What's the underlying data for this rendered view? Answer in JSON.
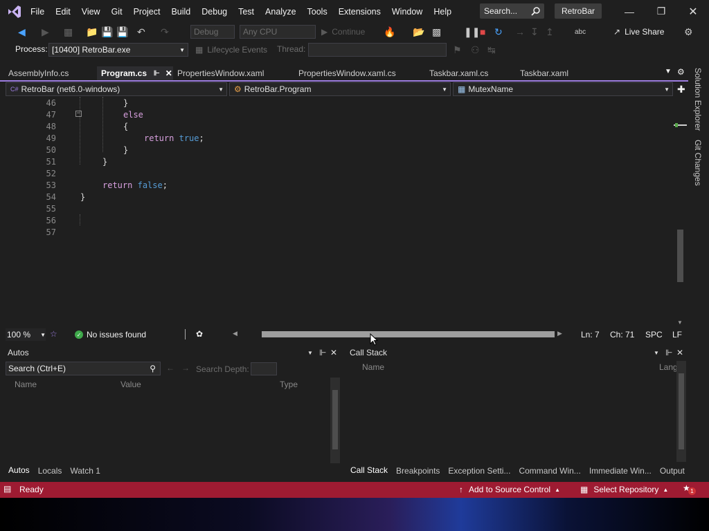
{
  "menu": {
    "items": [
      "File",
      "Edit",
      "View",
      "Git",
      "Project",
      "Build",
      "Debug",
      "Test",
      "Analyze",
      "Tools",
      "Extensions",
      "Window",
      "Help"
    ],
    "search_label": "Search...",
    "app_name": "RetroBar"
  },
  "toolbar": {
    "config": "Debug",
    "platform": "Any CPU",
    "continue_label": "Continue",
    "live_share_label": "Live Share"
  },
  "processbar": {
    "process_label": "Process:",
    "process_value": "[10400] RetroBar.exe",
    "lifecycle_label": "Lifecycle Events",
    "thread_label": "Thread:",
    "thread_value": ""
  },
  "tabs": [
    {
      "label": "AssemblyInfo.cs",
      "active": false
    },
    {
      "label": "Program.cs",
      "active": true
    },
    {
      "label": "PropertiesWindow.xaml",
      "active": false
    },
    {
      "label": "PropertiesWindow.xaml.cs",
      "active": false
    },
    {
      "label": "Taskbar.xaml.cs",
      "active": false
    },
    {
      "label": "Taskbar.xaml",
      "active": false
    }
  ],
  "navbar": {
    "project": "RetroBar (net6.0-windows)",
    "type": "RetroBar.Program",
    "member": "MutexName"
  },
  "editor": {
    "line_numbers": [
      "46",
      "47",
      "48",
      "49",
      "50",
      "51",
      "52",
      "53",
      "54",
      "55",
      "56",
      "57"
    ],
    "lines": [
      {
        "text": "}",
        "kind": "pn"
      },
      {
        "text": "else",
        "kind": "kw"
      },
      {
        "text": "{",
        "kind": "pn"
      },
      {
        "text_kw": "return",
        "text_val": "true",
        "tail": ";"
      },
      {
        "text": "}",
        "kind": "pn"
      },
      {
        "text": "}",
        "kind": "pn"
      },
      {
        "text": "",
        "kind": "pn"
      },
      {
        "text_kw": "return",
        "text_val": "false",
        "tail": ";"
      },
      {
        "text": "}",
        "kind": "pn"
      },
      {
        "text": "",
        "kind": "pn"
      },
      {
        "text": "",
        "kind": "pn"
      },
      {
        "text": "",
        "kind": "pn"
      }
    ]
  },
  "side": {
    "solution_explorer": "Solution Explorer",
    "git_changes": "Git Changes"
  },
  "editstatus": {
    "zoom": "100 %",
    "issues": "No issues found",
    "line": "Ln: 7",
    "col": "Ch: 71",
    "spacing": "SPC",
    "eol": "LF"
  },
  "autos": {
    "title": "Autos",
    "search_placeholder": "Search (Ctrl+E)",
    "search_depth_label": "Search Depth:",
    "columns": [
      "Name",
      "Value",
      "Type"
    ],
    "tabs": [
      "Autos",
      "Locals",
      "Watch 1"
    ]
  },
  "callstack": {
    "title": "Call Stack",
    "columns": [
      "Name",
      "Lang"
    ],
    "tabs": [
      "Call Stack",
      "Breakpoints",
      "Exception Setti...",
      "Command Win...",
      "Immediate Win...",
      "Output"
    ]
  },
  "statusbar": {
    "ready": "Ready",
    "add_source": "Add to Source Control",
    "select_repo": "Select Repository",
    "notifications": "1"
  },
  "colors": {
    "accent": "#9d7de0",
    "status_bar": "#9e1b32",
    "keyword": "#d8a0df",
    "literal": "#569cd6"
  }
}
